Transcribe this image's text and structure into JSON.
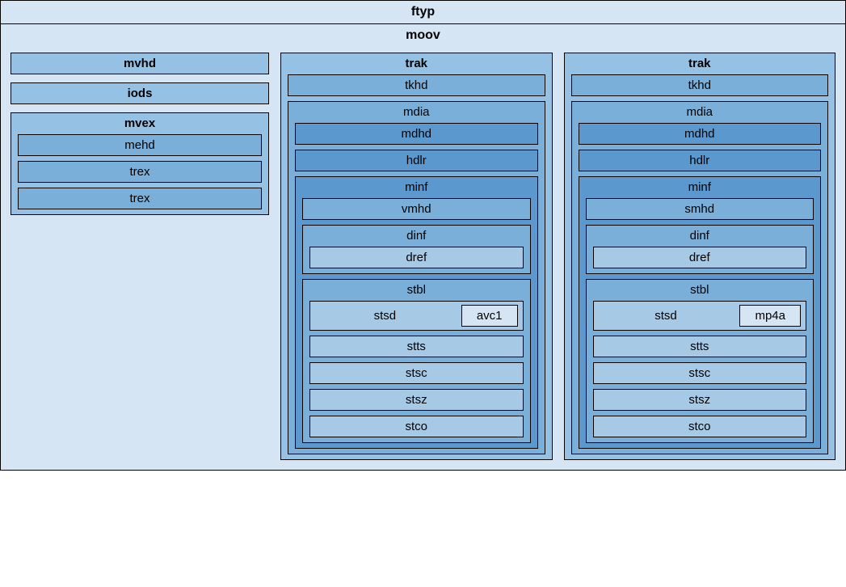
{
  "ftyp": "ftyp",
  "moov": {
    "label": "moov",
    "mvhd": "mvhd",
    "iods": "iods",
    "mvex": {
      "label": "mvex",
      "mehd": "mehd",
      "trex1": "trex",
      "trex2": "trex"
    },
    "trak1": {
      "label": "trak",
      "tkhd": "tkhd",
      "mdia": {
        "label": "mdia",
        "mdhd": "mdhd",
        "hdlr": "hdlr",
        "minf": {
          "label": "minf",
          "xmhd": "vmhd",
          "dinf": {
            "label": "dinf",
            "dref": "dref"
          },
          "stbl": {
            "label": "stbl",
            "stsd": {
              "label": "stsd",
              "codec": "avc1"
            },
            "stts": "stts",
            "stsc": "stsc",
            "stsz": "stsz",
            "stco": "stco"
          }
        }
      }
    },
    "trak2": {
      "label": "trak",
      "tkhd": "tkhd",
      "mdia": {
        "label": "mdia",
        "mdhd": "mdhd",
        "hdlr": "hdlr",
        "minf": {
          "label": "minf",
          "xmhd": "smhd",
          "dinf": {
            "label": "dinf",
            "dref": "dref"
          },
          "stbl": {
            "label": "stbl",
            "stsd": {
              "label": "stsd",
              "codec": "mp4a"
            },
            "stts": "stts",
            "stsc": "stsc",
            "stsz": "stsz",
            "stco": "stco"
          }
        }
      }
    }
  }
}
